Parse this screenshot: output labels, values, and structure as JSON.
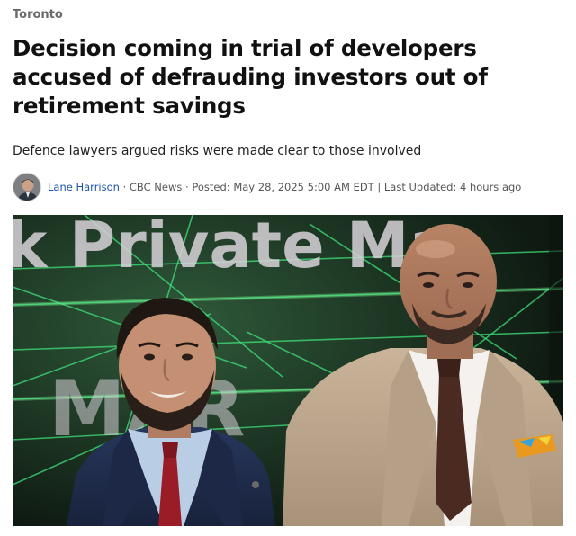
{
  "section": {
    "label": "Toronto"
  },
  "article": {
    "headline": "Decision coming in trial of developers accused of defrauding investors out of retirement savings",
    "deck": "Defence lawyers argued risks were made clear to those involved"
  },
  "byline": {
    "author": "Lane Harrison",
    "sep1": " · ",
    "outlet": "CBC News",
    "sep2": " · ",
    "posted": "Posted: May 28, 2025 5:00 AM EDT",
    "sep3": " | ",
    "updated": "Last Updated: 4 hours ago"
  },
  "photo": {
    "backdrop_text_top": "k Private Ma",
    "backdrop_text_mid": "MAR",
    "colors": {
      "grid": "#3fe07a",
      "backdrop": "#17281c",
      "text": "#d8d2d8"
    }
  }
}
